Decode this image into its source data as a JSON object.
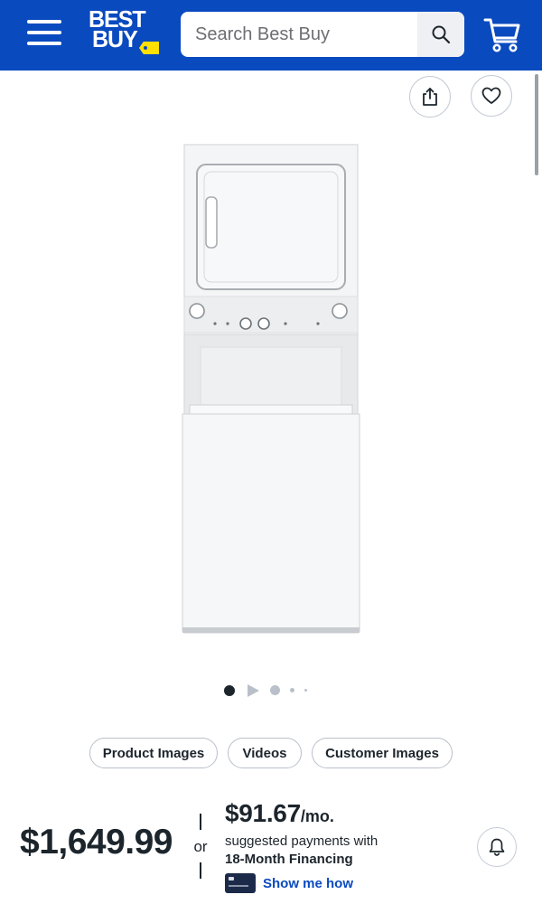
{
  "header": {
    "logo_text_line1": "BEST",
    "logo_text_line2": "BUY",
    "search_placeholder": "Search Best Buy",
    "colors": {
      "brand_blue": "#0a4abf",
      "tag_yellow": "#ffe000"
    },
    "icons": [
      "menu-icon",
      "search-icon",
      "cart-icon"
    ]
  },
  "actions": {
    "icons": [
      "share-icon",
      "heart-icon"
    ]
  },
  "gallery": {
    "active_index": 0,
    "dots": [
      {
        "type": "image",
        "active": true
      },
      {
        "type": "video",
        "active": false
      },
      {
        "type": "image",
        "active": false
      },
      {
        "type": "image",
        "active": false
      },
      {
        "type": "image",
        "active": false
      }
    ]
  },
  "media_tabs": [
    "Product Images",
    "Videos",
    "Customer Images"
  ],
  "pricing": {
    "price": "$1,649.99",
    "or": "or",
    "monthly_amount": "$91.67",
    "monthly_unit": "/mo.",
    "suggested": "suggested payments with",
    "financing": "18-Month Financing",
    "show_me_how": "Show me how",
    "link_color": "#0a4abf"
  }
}
